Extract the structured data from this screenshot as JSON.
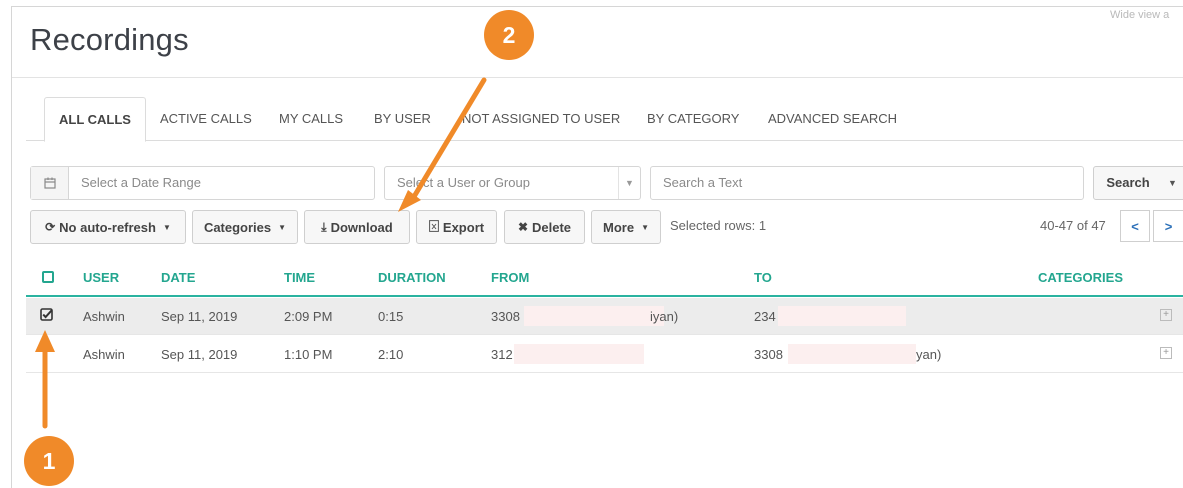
{
  "page": {
    "title": "Recordings",
    "corner_text": "Wide view a"
  },
  "tabs": [
    {
      "label": "ALL CALLS"
    },
    {
      "label": "ACTIVE CALLS"
    },
    {
      "label": "MY CALLS"
    },
    {
      "label": "BY USER"
    },
    {
      "label": "NOT ASSIGNED TO USER"
    },
    {
      "label": "BY CATEGORY"
    },
    {
      "label": "ADVANCED SEARCH"
    }
  ],
  "filters": {
    "date_placeholder": "Select a Date Range",
    "user_placeholder": "Select a User or Group",
    "text_placeholder": "Search a Text",
    "search_label": "Search"
  },
  "toolbar": {
    "refresh_label": "No auto-refresh",
    "categories_label": "Categories",
    "download_label": "Download",
    "export_label": "Export",
    "delete_label": "Delete",
    "more_label": "More",
    "selected_rows": "Selected rows: 1",
    "pager_text": "40-47 of 47"
  },
  "table": {
    "headers": {
      "user": "USER",
      "date": "DATE",
      "time": "TIME",
      "duration": "DURATION",
      "from": "FROM",
      "to": "TO",
      "categories": "CATEGORIES"
    },
    "rows": [
      {
        "selected": true,
        "user": "Ashwin",
        "date": "Sep 11, 2019",
        "time": "2:09 PM",
        "duration": "0:15",
        "from": "3308",
        "from_suffix": "iyan)",
        "to": "234",
        "to_suffix": ""
      },
      {
        "selected": false,
        "user": "Ashwin",
        "date": "Sep 11, 2019",
        "time": "1:10 PM",
        "duration": "2:10",
        "from": "312",
        "from_suffix": "",
        "to": "3308",
        "to_suffix": "yan)"
      }
    ]
  },
  "annotations": {
    "badge_1": "1",
    "badge_2": "2"
  },
  "colors": {
    "accent": "#23a68f",
    "annotation": "#f08a29",
    "pager_arrow": "#2a6fb8"
  }
}
